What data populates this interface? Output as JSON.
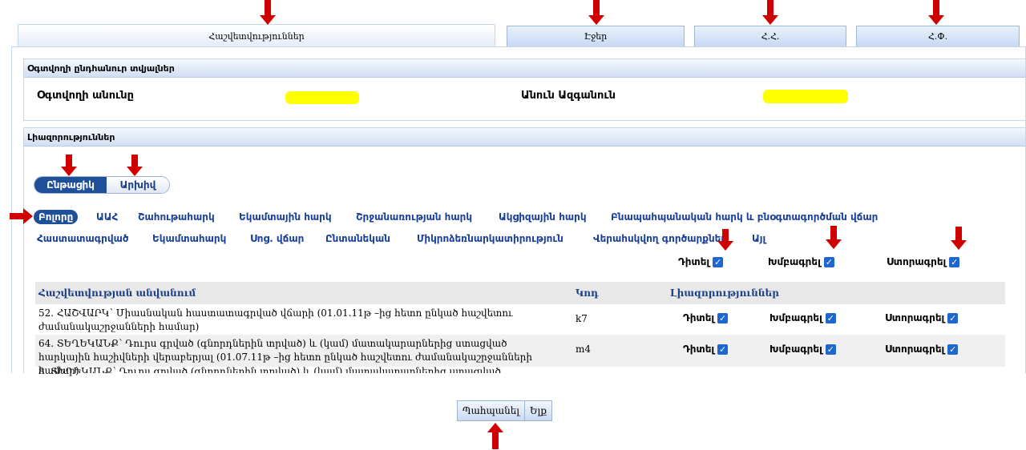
{
  "tabs": [
    {
      "label": "Հաշվետվություններ",
      "active": true
    },
    {
      "label": "Էջեր",
      "active": false
    },
    {
      "label": "Հ.Հ.",
      "active": false
    },
    {
      "label": "Հ.Փ.",
      "active": false
    }
  ],
  "user_panel": {
    "title": "Օգտվողի ընդհանուր տվյալներ",
    "username_label": "Օգտվողի անունը",
    "fullname_label": "Անուն Ազգանուն"
  },
  "permissions_panel": {
    "title": "Լիազորություններ",
    "toggle": {
      "current": "Ընթացիկ",
      "archive": "Արխիվ"
    },
    "categories_row1": [
      "Բոլորը",
      "ԱԱՀ",
      "Շահութահարկ",
      "Եկամտային հարկ",
      "Շրջանառության հարկ",
      "Ակցիզային հարկ",
      "Բնապահպանական հարկ և բնօգտագործման վճար"
    ],
    "categories_row2": [
      "Հաստատագրված",
      "Եկամտահարկ",
      "Սոց. վճար",
      "Ընտանեկան",
      "Միկրոձեռնարկատիրություն",
      "Վերահսկվող գործարքներ",
      "Այլ"
    ],
    "global_perms": {
      "view": "Դիտել",
      "edit": "Խմբագրել",
      "sign": "Ստորագրել"
    },
    "table": {
      "headers": {
        "name": "Հաշվետվության անվանում",
        "code": "Կոդ",
        "perms": "Լիազորություններ"
      },
      "rows": [
        {
          "name": "52. ՀԱՇՎԱՐԿ՝ Միասնական հաստատագրված վճարի (01.01.11թ –ից հետո ընկած հաշվետու ժամանակաշրջանների համար)",
          "code": "k7",
          "view": "Դիտել",
          "edit": "Խմբագրել",
          "sign": "Ստորագրել"
        },
        {
          "name": "64. ՏԵՂԵԿԱՆՔ՝ Դուրս գրված (գնորդներին տրված) և (կամ) մատակարարներից ստացված հարկային հաշիվների վերաբերյալ (01.07.11թ –ից հետո ընկած հաշվետու ժամանակաշրջանների համար)",
          "code": "m4",
          "view": "Դիտել",
          "edit": "Խմբագրել",
          "sign": "Ստորագրել"
        },
        {
          "name": "8. ՏԵՂԵԿԱՆՔ՝ Դուրս գրված (գնորդներին տրված) և (կամ) մատակարարներից ստացված հարկային",
          "code": "",
          "view": "",
          "edit": "",
          "sign": ""
        }
      ]
    }
  },
  "actions": {
    "save": "Պահպանել",
    "exit": "Ելք"
  },
  "colors": {
    "accent": "#1f4f98",
    "arrow": "#d00000",
    "highlight": "#ffff00"
  }
}
